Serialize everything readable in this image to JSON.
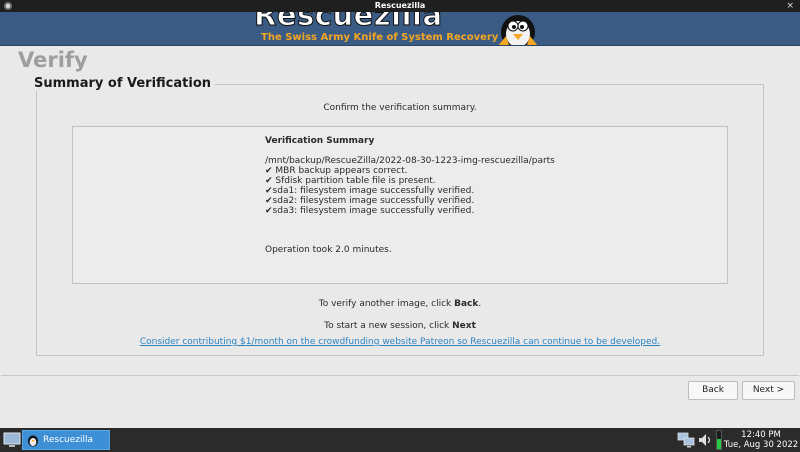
{
  "window": {
    "title": "Rescuezilla",
    "close_glyph": "×"
  },
  "banner": {
    "logo_text": "Rescuezilla",
    "tagline": "The Swiss Army Knife of System Recovery",
    "background": "#3a5b84",
    "tagline_color": "#f5a623"
  },
  "page": {
    "title": "Verify",
    "section_title": "Summary of Verification",
    "confirm_text": "Confirm the verification summary."
  },
  "summary": {
    "heading": "Verification Summary",
    "lines": [
      "/mnt/backup/RescueZilla/2022-08-30-1223-img-rescuezilla/parts",
      "✔ MBR backup appears correct.",
      "✔ Sfdisk partition table file is present.",
      "✔sda1: filesystem image successfully verified.",
      "✔sda2: filesystem image successfully verified.",
      "✔sda3: filesystem image successfully verified."
    ],
    "duration": "Operation took 2.0 minutes."
  },
  "hints": {
    "back_prefix": "To verify another image, click ",
    "back_bold": "Back",
    "back_suffix": ".",
    "next_prefix": "To start a new session, click ",
    "next_bold": "Next"
  },
  "patreon_link": "Consider contributing $1/month on the crowdfunding website Patreon so Rescuezilla can continue to be developed.",
  "buttons": {
    "back": "Back",
    "next": "Next >"
  },
  "taskbar": {
    "task_label": "Rescuezilla",
    "battery_level": 0.55,
    "battery_color": "#27c93f",
    "clock_time": "12:40 PM",
    "clock_date": "Tue, Aug 30 2022"
  }
}
